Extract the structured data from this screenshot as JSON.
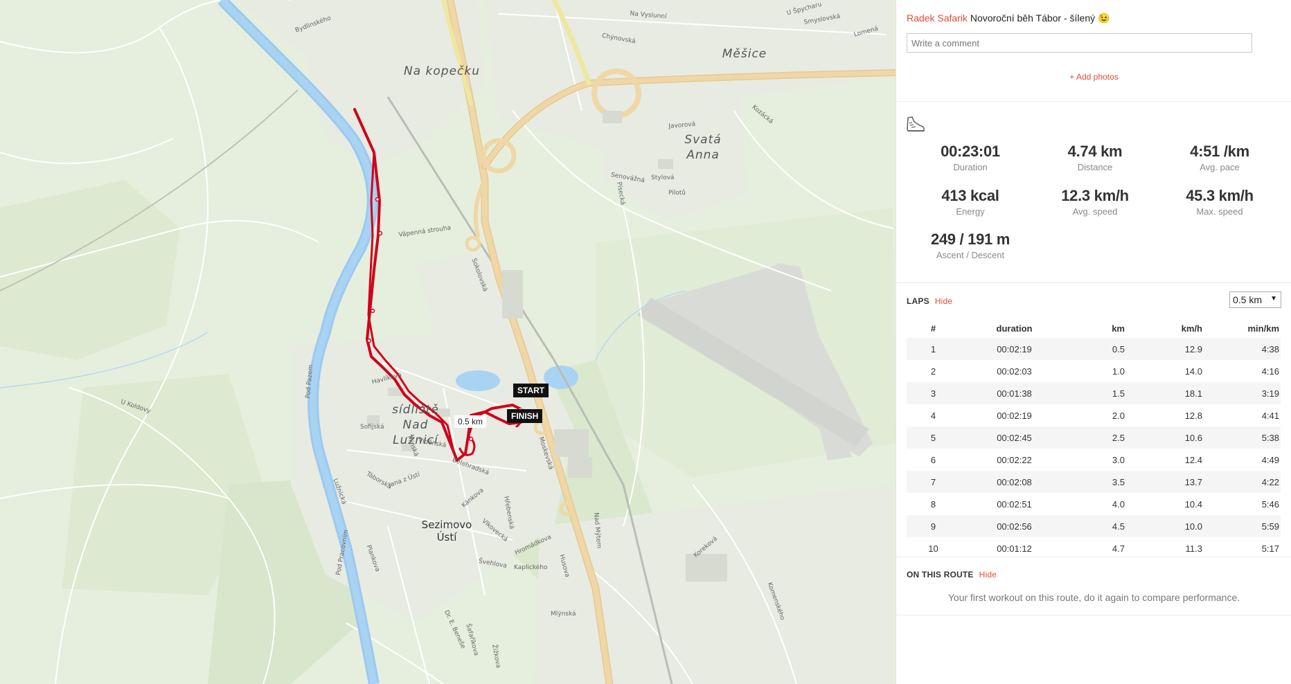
{
  "map": {
    "place_labels": [
      {
        "name": "Na kopečku"
      },
      {
        "name": "Měšice"
      },
      {
        "name": "Svatá Anna"
      },
      {
        "name": "sídliště Nad Lužnicí"
      }
    ],
    "town_label": "Sezimovo Ústí",
    "streets": [
      "Bydlinského",
      "Vápenná strouha",
      "Pod Pazem",
      "U Koldovy",
      "Havlíkova",
      "Sofijská",
      "Táborská",
      "Minská",
      "Jana z Ústí",
      "Viděnská",
      "Bělehradská",
      "Kánkova",
      "Vlkovecká",
      "Hřebenská",
      "Hromádkova",
      "Kaplického",
      "Švehlova",
      "Mlýnská",
      "Šafaříkova",
      "Moskevská",
      "Sokolovská",
      "Nad Mýtem",
      "Husova",
      "Pod Pracovním",
      "Lužnická",
      "Komenského",
      "Stylová",
      "Senovážná",
      "Písecká",
      "Pilotů",
      "Chýnovská",
      "Javorová",
      "Kozácká",
      "Smyslovská",
      "Lomená",
      "Na Vyslunní",
      "U Špycharu",
      "Koreková",
      "Dr. E. Beneše",
      "Žižkova",
      "Plankova"
    ],
    "flag_start": "START",
    "flag_finish": "FINISH",
    "km_marker": "0.5 km",
    "route_color": "#d0021b"
  },
  "activity": {
    "user": "Radek Safarik",
    "title": "Novoroční běh Tábor - šílený",
    "emoji": "😉",
    "comment_placeholder": "Write a comment",
    "add_photos": "+ Add photos",
    "sport_icon": "running-shoe-icon"
  },
  "stats": [
    {
      "value": "00:23:01",
      "label": "Duration"
    },
    {
      "value": "4.74 km",
      "label": "Distance"
    },
    {
      "value": "4:51 /km",
      "label": "Avg. pace"
    },
    {
      "value": "413 kcal",
      "label": "Energy"
    },
    {
      "value": "12.3 km/h",
      "label": "Avg. speed"
    },
    {
      "value": "45.3 km/h",
      "label": "Max. speed"
    },
    {
      "value": "249 / 191 m",
      "label": "Ascent / Descent"
    }
  ],
  "laps": {
    "title": "LAPS",
    "hide_label": "Hide",
    "interval": "0.5 km",
    "columns": [
      "#",
      "duration",
      "km",
      "km/h",
      "min/km"
    ],
    "rows": [
      [
        "1",
        "00:02:19",
        "0.5",
        "12.9",
        "4:38"
      ],
      [
        "2",
        "00:02:03",
        "1.0",
        "14.0",
        "4:16"
      ],
      [
        "3",
        "00:01:38",
        "1.5",
        "18.1",
        "3:19"
      ],
      [
        "4",
        "00:02:19",
        "2.0",
        "12.8",
        "4:41"
      ],
      [
        "5",
        "00:02:45",
        "2.5",
        "10.6",
        "5:38"
      ],
      [
        "6",
        "00:02:22",
        "3.0",
        "12.4",
        "4:49"
      ],
      [
        "7",
        "00:02:08",
        "3.5",
        "13.7",
        "4:22"
      ],
      [
        "8",
        "00:02:51",
        "4.0",
        "10.4",
        "5:46"
      ],
      [
        "9",
        "00:02:56",
        "4.5",
        "10.0",
        "5:59"
      ],
      [
        "10",
        "00:01:12",
        "4.7",
        "11.3",
        "5:17"
      ]
    ]
  },
  "route": {
    "title": "ON THIS ROUTE",
    "hide_label": "Hide",
    "note": "Your first workout on this route, do it again to compare performance."
  }
}
